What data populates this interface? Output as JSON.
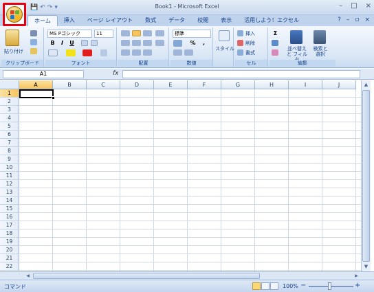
{
  "window": {
    "title": "Book1 - Microsoft Excel",
    "controls": {
      "minimize": "–",
      "maximize": "□",
      "close": "×"
    }
  },
  "qat": {
    "save": "💾",
    "undo": "↶",
    "redo": "↷",
    "customize": "▾"
  },
  "tabs": [
    {
      "label": "ホーム",
      "active": true
    },
    {
      "label": "挿入"
    },
    {
      "label": "ページ レイアウト"
    },
    {
      "label": "数式"
    },
    {
      "label": "データ"
    },
    {
      "label": "校閲"
    },
    {
      "label": "表示"
    },
    {
      "label": "活用しよう！エクセル"
    }
  ],
  "ribbon_right": {
    "help": "?",
    "min": "–",
    "restore": "▫",
    "close": "×"
  },
  "groups": {
    "clipboard": {
      "label": "クリップボード",
      "paste": "貼り付け"
    },
    "font": {
      "label": "フォント",
      "font_name": "MS Pゴシック",
      "font_size": "11",
      "bold": "B",
      "italic": "I",
      "underline": "U"
    },
    "alignment": {
      "label": "配置"
    },
    "number": {
      "label": "数値",
      "format": "標準",
      "percent": "%",
      "comma": ","
    },
    "styles": {
      "label": "スタイル"
    },
    "cells": {
      "label": "セル",
      "insert": "挿入",
      "delete": "削除",
      "format": "書式"
    },
    "editing": {
      "label": "編集",
      "sort_filter": "並べ替えと フィルタ",
      "find_select": "検索と 選択"
    }
  },
  "formula_bar": {
    "name_box": "A1",
    "fx": "fx",
    "value": ""
  },
  "columns": [
    "A",
    "B",
    "C",
    "D",
    "E",
    "F",
    "G",
    "H",
    "I",
    "J"
  ],
  "rows": [
    "1",
    "2",
    "3",
    "4",
    "5",
    "6",
    "7",
    "8",
    "9",
    "10",
    "11",
    "12",
    "13",
    "14",
    "15",
    "16",
    "17",
    "18",
    "19",
    "20",
    "21",
    "22"
  ],
  "selected_cell": "A1",
  "status": {
    "mode": "コマンド",
    "zoom": "100%",
    "minus": "−",
    "plus": "+"
  }
}
